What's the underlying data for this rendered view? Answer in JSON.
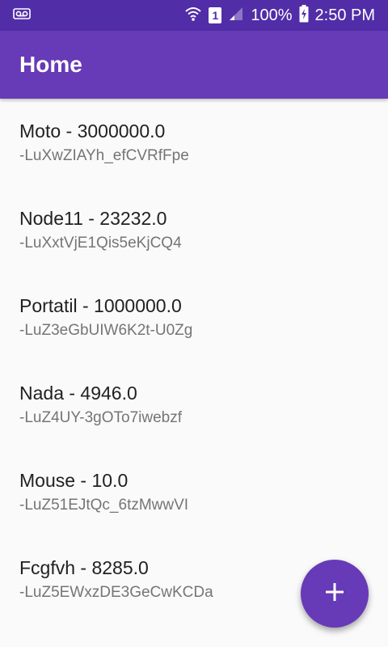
{
  "status_bar": {
    "left_icon": "voicemail-icon",
    "wifi_icon": "wifi-icon",
    "sim_label": "1",
    "signal_icon": "signal-icon",
    "battery_percent": "100%",
    "battery_icon": "battery-charging-icon",
    "time": "2:50 PM"
  },
  "app_bar": {
    "title": "Home"
  },
  "items": [
    {
      "title": "Moto - 3000000.0",
      "subtitle": "-LuXwZIAYh_efCVRfFpe"
    },
    {
      "title": "Node11 - 23232.0",
      "subtitle": "-LuXxtVjE1Qis5eKjCQ4"
    },
    {
      "title": "Portatil - 1000000.0",
      "subtitle": "-LuZ3eGbUIW6K2t-U0Zg"
    },
    {
      "title": "Nada - 4946.0",
      "subtitle": "-LuZ4UY-3gOTo7iwebzf"
    },
    {
      "title": "Mouse - 10.0",
      "subtitle": "-LuZ51EJtQc_6tzMwwVI"
    },
    {
      "title": "Fcgfvh - 8285.0",
      "subtitle": "-LuZ5EWxzDE3GeCwKCDa"
    }
  ],
  "fab": {
    "icon": "plus-icon"
  },
  "colors": {
    "primary": "#673ab7",
    "primary_dark": "#512da8",
    "background": "#fafafa"
  }
}
